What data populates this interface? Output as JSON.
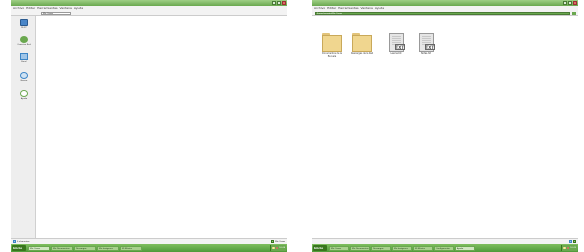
{
  "left_window": {
    "menu": [
      "Archivo",
      "Editar",
      "Herramientas",
      "Ventana",
      "Ayuda"
    ],
    "address": "Mis Cosas",
    "side_items": [
      {
        "label": "Mi PC",
        "icon": "computer-icon"
      },
      {
        "label": "Conectar Red",
        "icon": "network-icon"
      },
      {
        "label": "Panel",
        "icon": "control-panel-icon"
      },
      {
        "label": "Buscar",
        "icon": "search-icon"
      },
      {
        "label": "Ayuda",
        "icon": "help-icon"
      }
    ],
    "status_left": "0 elementos",
    "status_right": "Mis Cosas",
    "taskbar": {
      "start": "Inicio",
      "tasks": [
        "Mis Cosas",
        "Mis Documentos",
        "Descargas",
        "Mis Imágenes",
        "Mi Música"
      ],
      "clock": "10:24"
    }
  },
  "right_window": {
    "menu": [
      "Archivo",
      "Editar",
      "Herramientas",
      "Ventana",
      "Ayuda"
    ],
    "address": "/home/usuario/Mis Cosas",
    "files": [
      {
        "name": "Documentos de la Escuela",
        "type": "folder"
      },
      {
        "name": "Descargas de la Red",
        "type": "folder"
      },
      {
        "name": "Leeme.txt",
        "type": "txt"
      },
      {
        "name": "Notas.txt",
        "type": "txt"
      }
    ],
    "file_badge": "TXT",
    "taskbar": {
      "start": "Inicio",
      "tasks": [
        "Mis Cosas",
        "Mis Documentos",
        "Descargas",
        "Mis Imágenes",
        "Mi Música",
        "Configuración",
        "Ayuda"
      ],
      "clock": "10:25"
    }
  },
  "colors": {
    "accent": "#6aa84f",
    "titlebar": "#9fcf86",
    "folder": "#f0d68f",
    "close": "#e06666"
  }
}
